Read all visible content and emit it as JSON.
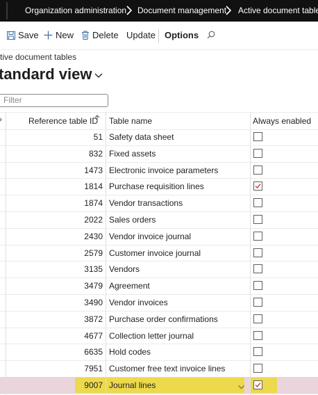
{
  "breadcrumb": [
    {
      "label": "Organization administration"
    },
    {
      "label": "Document management"
    },
    {
      "label": "Active document tables"
    }
  ],
  "actions": {
    "save": "Save",
    "new": "New",
    "delete": "Delete",
    "update": "Update",
    "options": "Options"
  },
  "page": {
    "label": "tive document tables",
    "view_title": "tandard view"
  },
  "filter": {
    "placeholder": "Filter"
  },
  "columns": {
    "reference_id": "Reference table ID",
    "table_name": "Table name",
    "always_enabled": "Always enabled"
  },
  "rows": [
    {
      "id": "51",
      "name": "Safety data sheet",
      "enabled": false
    },
    {
      "id": "832",
      "name": "Fixed assets",
      "enabled": false
    },
    {
      "id": "1473",
      "name": "Electronic invoice parameters",
      "enabled": false
    },
    {
      "id": "1814",
      "name": "Purchase requisition lines",
      "enabled": true
    },
    {
      "id": "1874",
      "name": "Vendor transactions",
      "enabled": false
    },
    {
      "id": "2022",
      "name": "Sales orders",
      "enabled": false
    },
    {
      "id": "2430",
      "name": "Vendor invoice journal",
      "enabled": false
    },
    {
      "id": "2579",
      "name": "Customer invoice journal",
      "enabled": false
    },
    {
      "id": "3135",
      "name": "Vendors",
      "enabled": false
    },
    {
      "id": "3479",
      "name": "Agreement",
      "enabled": false
    },
    {
      "id": "3490",
      "name": "Vendor invoices",
      "enabled": false
    },
    {
      "id": "3872",
      "name": "Purchase order confirmations",
      "enabled": false
    },
    {
      "id": "4677",
      "name": "Collection letter journal",
      "enabled": false
    },
    {
      "id": "6635",
      "name": "Hold codes",
      "enabled": false
    },
    {
      "id": "7951",
      "name": "Customer free text invoice lines",
      "enabled": false
    },
    {
      "id": "9007",
      "name": "Journal lines",
      "enabled": true,
      "selected": true
    }
  ],
  "colors": {
    "selected_row": "#ead5dd",
    "highlight": "#ecd94c",
    "check": "#a4262c"
  }
}
